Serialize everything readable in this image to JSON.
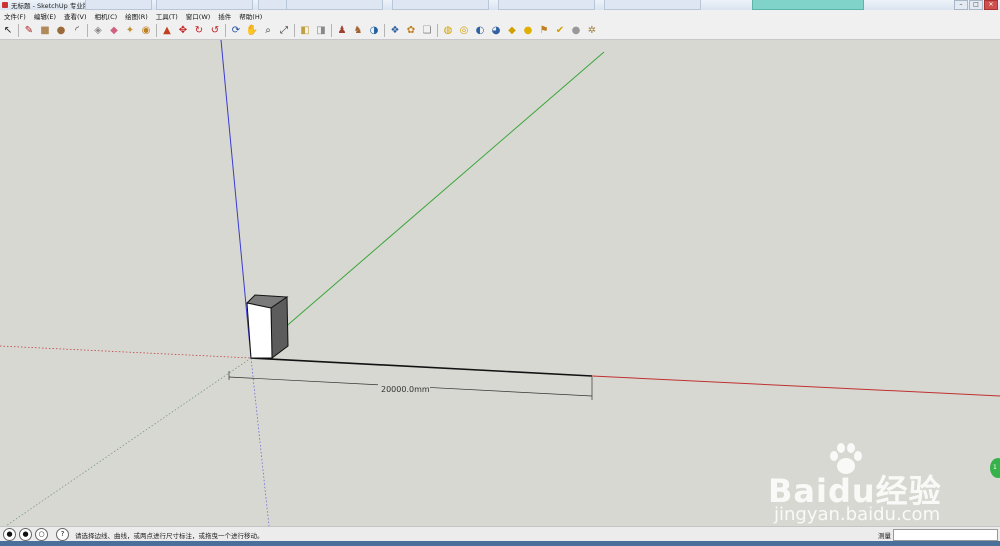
{
  "window": {
    "title": "无标题 - SketchUp 专业版",
    "controls": {
      "minimize": "–",
      "maximize": "□",
      "close": "✕"
    }
  },
  "menu": [
    "文件(F)",
    "编辑(E)",
    "查看(V)",
    "相机(C)",
    "绘图(R)",
    "工具(T)",
    "窗口(W)",
    "插件",
    "帮助(H)"
  ],
  "toolbar": [
    {
      "name": "select-tool-icon",
      "glyph": "↖",
      "color": "#222"
    },
    {
      "sep": true
    },
    {
      "name": "line-tool-icon",
      "glyph": "✎",
      "color": "#b02020"
    },
    {
      "name": "rectangle-tool-icon",
      "glyph": "■",
      "color": "#b08a5a"
    },
    {
      "name": "circle-tool-icon",
      "glyph": "●",
      "color": "#9a6a3a"
    },
    {
      "name": "arc-tool-icon",
      "glyph": "◜",
      "color": "#333"
    },
    {
      "sep": true
    },
    {
      "name": "make-component-icon",
      "glyph": "◈",
      "color": "#888"
    },
    {
      "name": "eraser-tool-icon",
      "glyph": "◆",
      "color": "#d06080"
    },
    {
      "name": "tape-measure-icon",
      "glyph": "✦",
      "color": "#c09030"
    },
    {
      "name": "paint-bucket-icon",
      "glyph": "◉",
      "color": "#c08020"
    },
    {
      "sep": true
    },
    {
      "name": "push-pull-icon",
      "glyph": "▲",
      "color": "#c04020"
    },
    {
      "name": "move-tool-icon",
      "glyph": "✥",
      "color": "#c02020"
    },
    {
      "name": "rotate-tool-icon",
      "glyph": "↻",
      "color": "#c02020"
    },
    {
      "name": "offset-tool-icon",
      "glyph": "↺",
      "color": "#c02020"
    },
    {
      "sep": true
    },
    {
      "name": "orbit-tool-icon",
      "glyph": "⟳",
      "color": "#2050a0"
    },
    {
      "name": "pan-tool-icon",
      "glyph": "✋",
      "color": "#444"
    },
    {
      "name": "zoom-tool-icon",
      "glyph": "⌕",
      "color": "#333"
    },
    {
      "name": "zoom-extents-icon",
      "glyph": "⤢",
      "color": "#333"
    },
    {
      "sep": true
    },
    {
      "name": "previous-view-icon",
      "glyph": "◧",
      "color": "#c0a040"
    },
    {
      "name": "next-view-icon",
      "glyph": "◨",
      "color": "#888"
    },
    {
      "sep": true
    },
    {
      "name": "position-camera-icon",
      "glyph": "♟",
      "color": "#a04030"
    },
    {
      "name": "walk-tool-icon",
      "glyph": "♞",
      "color": "#a06030"
    },
    {
      "name": "look-around-icon",
      "glyph": "◑",
      "color": "#2060a0"
    },
    {
      "sep": true
    },
    {
      "name": "components-icon",
      "glyph": "❖",
      "color": "#3060a0"
    },
    {
      "name": "materials-icon",
      "glyph": "✿",
      "color": "#c08020"
    },
    {
      "name": "styles-icon",
      "glyph": "❏",
      "color": "#888"
    },
    {
      "sep": true
    },
    {
      "name": "google-earth-icon",
      "glyph": "◍",
      "color": "#d0a000"
    },
    {
      "name": "get-models-icon",
      "glyph": "◎",
      "color": "#d0a000"
    },
    {
      "name": "share-model-icon",
      "glyph": "◐",
      "color": "#3060a0"
    },
    {
      "name": "upload-component-icon",
      "glyph": "◕",
      "color": "#3060a0"
    },
    {
      "name": "extension-warehouse-icon",
      "glyph": "◆",
      "color": "#d0a000"
    },
    {
      "name": "sun-icon",
      "glyph": "●",
      "color": "#e0b000"
    },
    {
      "name": "flag-icon",
      "glyph": "⚑",
      "color": "#c08020"
    },
    {
      "name": "pin-icon",
      "glyph": "✔",
      "color": "#d0a000"
    },
    {
      "name": "sphere-icon",
      "glyph": "●",
      "color": "#999"
    },
    {
      "name": "sandbox-icon",
      "glyph": "✲",
      "color": "#a08040"
    }
  ],
  "scene": {
    "dimension_text": "20000.0mm",
    "axis_colors": {
      "red": "#c03030",
      "green": "#3aa53a",
      "blue": "#3a3ad0"
    }
  },
  "status": {
    "hint": "请选择边线、曲线，或两点进行尺寸标注，或拖曳一个进行移动。",
    "measure_label": "测量",
    "measure_value": ""
  },
  "watermark": {
    "logo": "Baidu经验",
    "url": "jingyan.baidu.com"
  }
}
